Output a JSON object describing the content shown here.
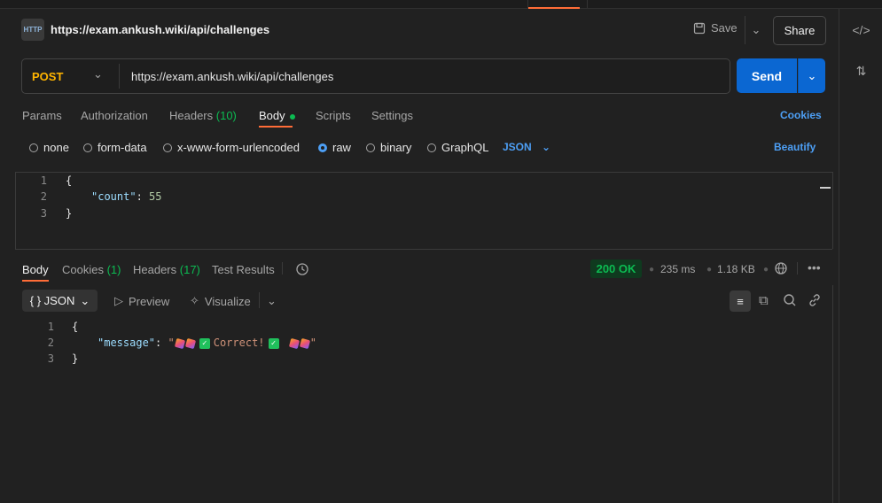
{
  "request": {
    "title": "https://exam.ankush.wiki/api/challenges",
    "method": "POST",
    "url": "https://exam.ankush.wiki/api/challenges",
    "http_icon": "HTTP",
    "save_label": "Save",
    "share_label": "Share",
    "send_label": "Send"
  },
  "request_tabs": {
    "params": "Params",
    "authorization": "Authorization",
    "headers": "Headers",
    "headers_count": "(10)",
    "body": "Body",
    "scripts": "Scripts",
    "settings": "Settings",
    "cookies": "Cookies"
  },
  "body_types": {
    "none": "none",
    "form_data": "form-data",
    "urlencoded": "x-www-form-urlencoded",
    "raw": "raw",
    "binary": "binary",
    "graphql": "GraphQL",
    "format": "JSON",
    "beautify": "Beautify",
    "selected": "raw"
  },
  "request_body": {
    "line_numbers": [
      "1",
      "2",
      "3"
    ],
    "open_brace": "{",
    "key": "\"count\"",
    "colon": ": ",
    "value": "55",
    "close_brace": "}"
  },
  "response_tabs": {
    "body": "Body",
    "cookies": "Cookies",
    "cookies_count": "(1)",
    "headers": "Headers",
    "headers_count": "(17)",
    "test_results": "Test Results"
  },
  "response_meta": {
    "status": "200 OK",
    "time": "235 ms",
    "size": "1.18 KB"
  },
  "response_toolbar": {
    "format": "{ } JSON",
    "preview": "Preview",
    "visualize": "Visualize"
  },
  "response_body": {
    "line_numbers": [
      "1",
      "2",
      "3"
    ],
    "open_brace": "{",
    "key": "\"message\"",
    "colon": ": ",
    "quote_open": "\"",
    "correct_text": "Correct!",
    "quote_close": "\"",
    "close_brace": "}"
  },
  "colors": {
    "accent": "#ff6c37",
    "send": "#0b67d2",
    "method": "#ffb400",
    "success": "#0cbb52",
    "link": "#4d9ff5"
  }
}
